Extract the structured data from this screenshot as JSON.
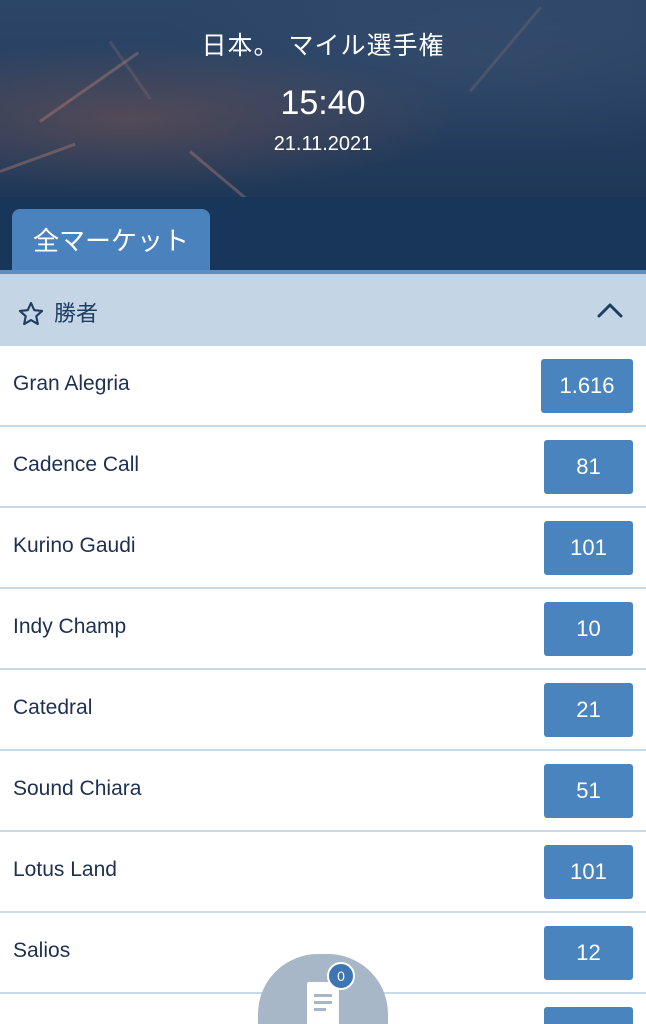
{
  "event": {
    "title": "日本。 マイル選手権",
    "time": "15:40",
    "date": "21.11.2021"
  },
  "tabs": [
    {
      "label": "全マーケット",
      "active": true
    }
  ],
  "market": {
    "title": "勝者",
    "favorite_icon": "star-outline-icon",
    "collapse_icon": "chevron-up-icon"
  },
  "runners": [
    {
      "name": "Gran Alegria",
      "odds": "1.616"
    },
    {
      "name": "Cadence Call",
      "odds": "81"
    },
    {
      "name": "Kurino Gaudi",
      "odds": "101"
    },
    {
      "name": "Indy Champ",
      "odds": "10"
    },
    {
      "name": "Catedral",
      "odds": "21"
    },
    {
      "name": "Sound Chiara",
      "odds": "51"
    },
    {
      "name": "Lotus Land",
      "odds": "101"
    },
    {
      "name": "Salios",
      "odds": "12"
    },
    {
      "name": "",
      "odds": ""
    }
  ],
  "betslip": {
    "count": "0",
    "icon": "betslip-document-icon"
  },
  "colors": {
    "header_bg": "#243d5e",
    "tabbar_bg": "#17365a",
    "active_tab": "#4a82bd",
    "market_header_bg": "#c4d6e6",
    "odds_button": "#4a84be",
    "text_dark": "#1e3050"
  }
}
